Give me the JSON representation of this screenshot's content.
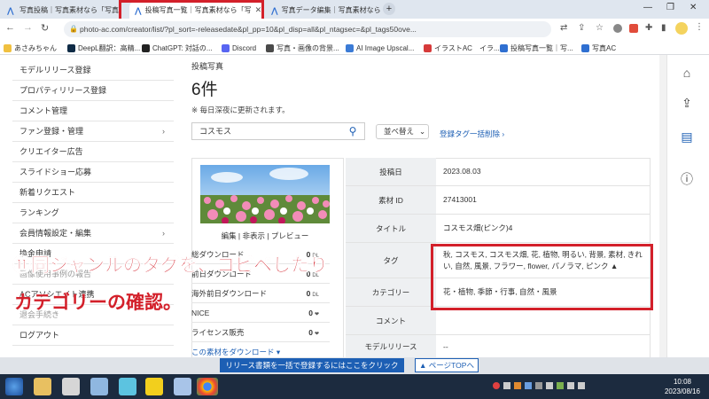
{
  "browser": {
    "tabs": [
      {
        "label": "写真投稿｜写真素材なら「写真"
      },
      {
        "label": "投稿写真一覧｜写真素材なら「写"
      },
      {
        "label": "写真データ編集｜写真素材なら"
      }
    ],
    "url": "photo-ac.com/creator/list/?pl_sort=-releasedate&pl_pp=10&pl_disp=all&pl_ntagsec=&pl_tags50ove..."
  },
  "bookmarks": [
    {
      "label": "あさみちゃん",
      "color": "#f0c040"
    },
    {
      "label": "DeepL翻訳：高精...",
      "color": "#0f2b46"
    },
    {
      "label": "ChatGPT: 対話の...",
      "color": "#222222"
    },
    {
      "label": "Discord",
      "color": "#5865f2"
    },
    {
      "label": "写真・画像の背景...",
      "color": "#4a4a4a"
    },
    {
      "label": "AI Image Upscal...",
      "color": "#3b7bd6"
    },
    {
      "label": "イラストAC　イラ...",
      "color": "#d63a3a"
    },
    {
      "label": "投稿写真一覧｜写...",
      "color": "#2f6fd1"
    },
    {
      "label": "写真AC",
      "color": "#2f6fd1"
    }
  ],
  "sidebar": {
    "items": [
      {
        "label": "モデルリリース登録",
        "chev": ""
      },
      {
        "label": "プロパティリリース登録",
        "chev": ""
      },
      {
        "label": "コメント管理",
        "chev": ""
      },
      {
        "label": "ファン登録・管理",
        "chev": "›"
      },
      {
        "label": "クリエイター広告",
        "chev": ""
      },
      {
        "label": "スライドショー応募",
        "chev": ""
      },
      {
        "label": "新着リクエスト",
        "chev": ""
      },
      {
        "label": "ランキング",
        "chev": ""
      },
      {
        "label": "会員情報設定・編集",
        "chev": "›"
      },
      {
        "label": "換金申請",
        "chev": ""
      },
      {
        "label": "画像使用事例の報告",
        "chev": ""
      },
      {
        "label": "ACアソシエイト連携",
        "chev": ""
      },
      {
        "label": "退会手続き",
        "chev": ""
      },
      {
        "label": "ログアウト",
        "chev": ""
      }
    ]
  },
  "main": {
    "section_title": "投稿写真",
    "count": "6件",
    "note": "※ 毎日深夜に更新されます。",
    "search_value": "コスモス",
    "sort_label": "並べ替え",
    "bulk_delete_link": "登録タグ一括削除 ›",
    "photo_actions": "編集 | 非表示 | プレビュー",
    "stats": [
      {
        "label": "総ダウンロード",
        "value": "0",
        "unit": "DL"
      },
      {
        "label": "前日ダウンロード",
        "value": "0",
        "unit": "DL"
      },
      {
        "label": "海外前日ダウンロード",
        "value": "0",
        "unit": "DL"
      },
      {
        "label": "NICE",
        "value": "0",
        "unit": "❤"
      },
      {
        "label": "ライセンス販売",
        "value": "0",
        "unit": "❤"
      },
      {
        "label": "この素材をダウンロード ▾",
        "value": "",
        "unit": ""
      }
    ],
    "details": [
      {
        "label": "投稿日",
        "value": "2023.08.03"
      },
      {
        "label": "素材 ID",
        "value": "27413001"
      },
      {
        "label": "タイトル",
        "value": "コスモス畑(ピンク)4"
      },
      {
        "label": "タグ",
        "value": "秋, コスモス, コスモス畑, 花, 植物, 明るい, 背景, 素材, きれい, 自然, 風景, フラワー, flower, パノラマ, ピンク ▲"
      },
      {
        "label": "カテゴリー",
        "value": "花・植物, 季節・行事, 自然・風景"
      },
      {
        "label": "コメント",
        "value": ""
      },
      {
        "label": "モデルリリース",
        "value": "--"
      }
    ]
  },
  "annotation": {
    "line1": "⑪同ジャンルのタグを、コピペしたり",
    "line2": "カテゴリーの確認。"
  },
  "footer": {
    "bulk_button": "リリース書類を一括で登録するにはここをクリック",
    "top_button": "▲ ページTOPへ"
  },
  "taskbar": {
    "time": "10:08",
    "date": "2023/08/16"
  }
}
